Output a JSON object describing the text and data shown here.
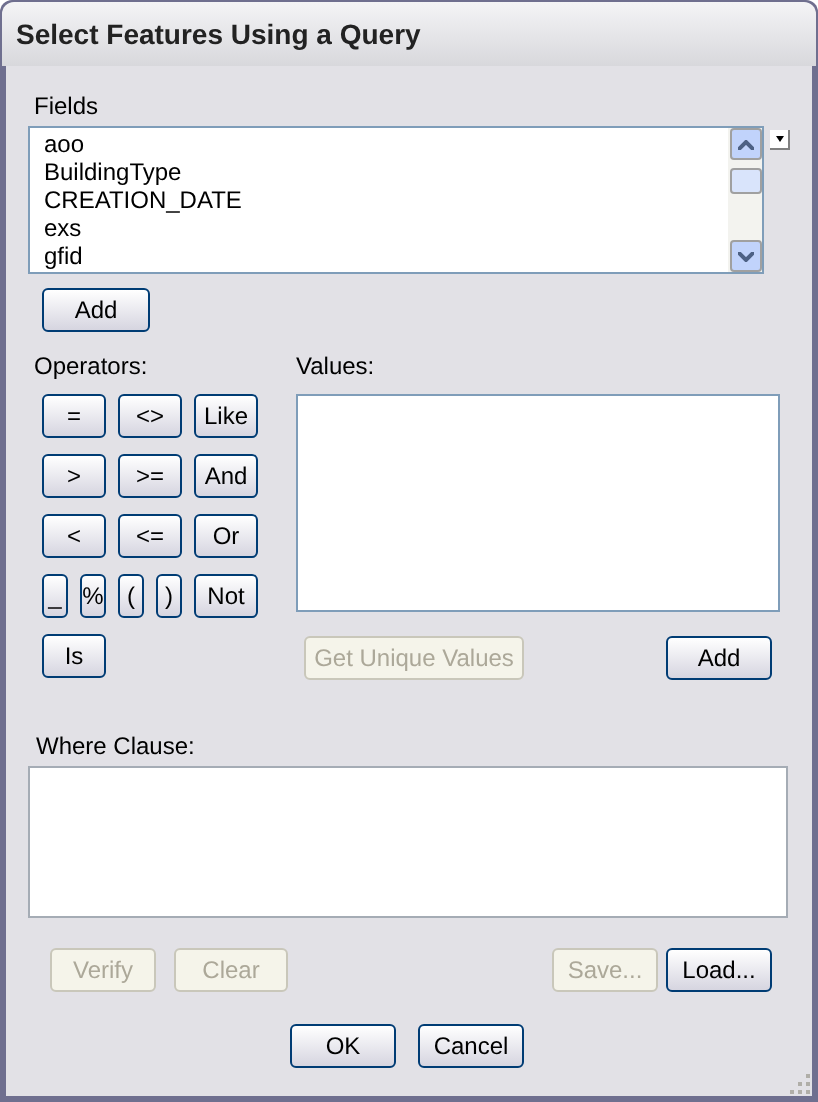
{
  "window": {
    "title": "Select Features Using a Query"
  },
  "fields": {
    "label": "Fields",
    "items": [
      {
        "text": "aoo",
        "selected": false
      },
      {
        "text": "BuildingType",
        "selected": false
      },
      {
        "text": "CREATION_DATE",
        "selected": false
      },
      {
        "text": "exs",
        "selected": false
      },
      {
        "text": "gfid",
        "selected": false
      }
    ],
    "add_button": {
      "label": "Add",
      "disabled": false
    }
  },
  "operators": {
    "label": "Operators:",
    "rows": [
      [
        {
          "label": "=",
          "kind": "wide"
        },
        {
          "label": "<>",
          "kind": "wide"
        },
        {
          "label": "Like",
          "kind": "wide"
        }
      ],
      [
        {
          "label": ">",
          "kind": "wide"
        },
        {
          "label": ">=",
          "kind": "wide"
        },
        {
          "label": "And",
          "kind": "wide"
        }
      ],
      [
        {
          "label": "<",
          "kind": "wide"
        },
        {
          "label": "<=",
          "kind": "wide"
        },
        {
          "label": "Or",
          "kind": "wide"
        }
      ],
      [
        {
          "label": "_",
          "kind": "narrow"
        },
        {
          "label": "%",
          "kind": "narrow"
        },
        {
          "label": "(",
          "kind": "narrow"
        },
        {
          "label": ")",
          "kind": "narrow"
        },
        {
          "label": "Not",
          "kind": "wide"
        }
      ],
      [
        {
          "label": "Is",
          "kind": "wide"
        }
      ]
    ]
  },
  "values": {
    "label": "Values:",
    "unique_button": {
      "label": "Get Unique Values",
      "disabled": true
    },
    "add_button": {
      "label": "Add",
      "disabled": false
    }
  },
  "where_clause": {
    "label": "Where Clause:"
  },
  "clause_buttons": [
    {
      "label": "Verify",
      "disabled": true
    },
    {
      "label": "Clear",
      "disabled": true
    },
    {
      "label": "Save...",
      "disabled": true
    },
    {
      "label": "Load...",
      "disabled": false
    }
  ],
  "dialog_buttons": [
    {
      "label": "OK",
      "disabled": false
    },
    {
      "label": "Cancel",
      "disabled": false
    }
  ]
}
